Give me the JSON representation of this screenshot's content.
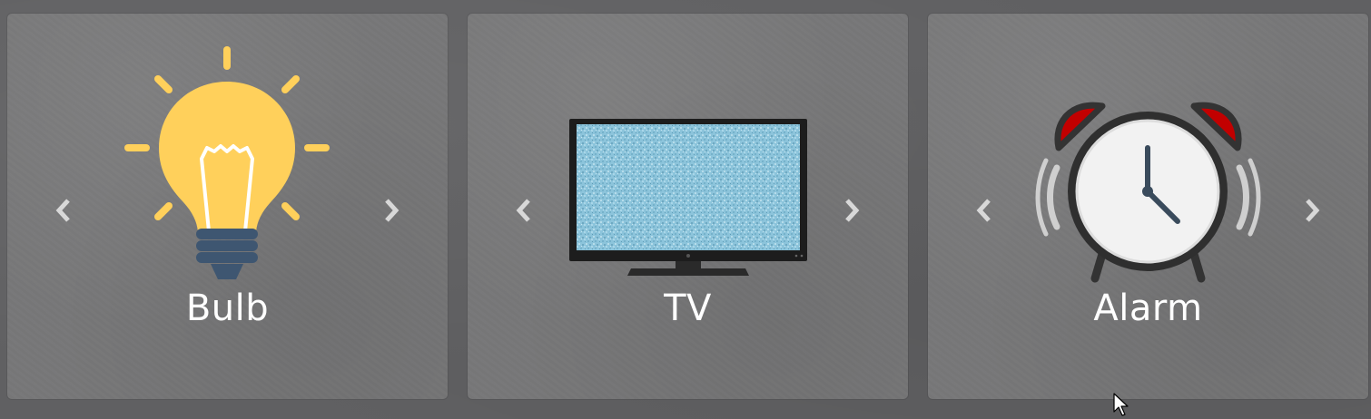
{
  "cards": [
    {
      "label": "Bulb",
      "icon": "lightbulb-icon"
    },
    {
      "label": "TV",
      "icon": "tv-icon"
    },
    {
      "label": "Alarm",
      "icon": "alarm-clock-icon"
    }
  ],
  "navigation": {
    "prev_icon": "chevron-left-icon",
    "next_icon": "chevron-right-icon"
  },
  "colors": {
    "page_background": "#606062",
    "card_background": "#777778",
    "label_text": "#ffffff",
    "chevron": "#d8d8d8",
    "bulb_yellow": "#ffd05b",
    "bulb_base": "#3e5671",
    "tv_screen": "#8cc4db",
    "alarm_bell_red": "#c20000"
  }
}
